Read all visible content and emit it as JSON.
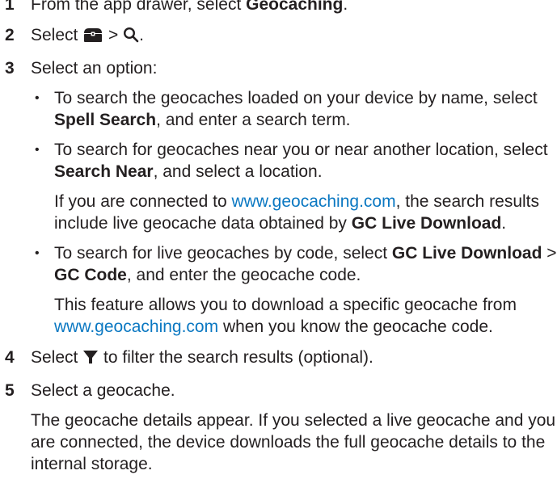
{
  "steps": [
    {
      "num": "1",
      "pre": "From the app drawer, select ",
      "bold": "Geocaching",
      "post": "."
    },
    {
      "num": "2",
      "pre": "Select ",
      "sep": " > ",
      "post": ".",
      "icons": [
        "geocache-box-icon",
        "search-icon"
      ]
    },
    {
      "num": "3",
      "text": "Select an option:",
      "options": [
        {
          "t1": "To search the geocaches loaded on your device by name, select ",
          "b1": "Spell Search",
          "t2": ", and enter a search term."
        },
        {
          "t1": "To search for geocaches near you or near another location, select ",
          "b1": "Search Near",
          "t2": ", and select a location.",
          "note": {
            "t1": "If you are connected to ",
            "link": "www.geocaching.com",
            "t2": ", the search results include live geocache data obtained by ",
            "b1": "GC Live Download",
            "t3": "."
          }
        },
        {
          "t1": "To search for live geocaches by code, select ",
          "b1": "GC Live Download",
          "t2": " > ",
          "b2": "GC Code",
          "t3": ", and enter the geocache code.",
          "note": {
            "t1": "This feature allows you to download a specific geocache from ",
            "link": "www.geocaching.com",
            "t2": " when you know the geocache code."
          }
        }
      ]
    },
    {
      "num": "4",
      "pre": "Select ",
      "post": " to filter the search results (optional).",
      "icons": [
        "filter-icon"
      ]
    },
    {
      "num": "5",
      "text": "Select a geocache.",
      "para": "The geocache details appear. If you selected a live geocache and you are connected, the device downloads the full geocache details to the internal storage."
    }
  ],
  "colors": {
    "text": "#231f20",
    "link": "#0b78c2"
  }
}
